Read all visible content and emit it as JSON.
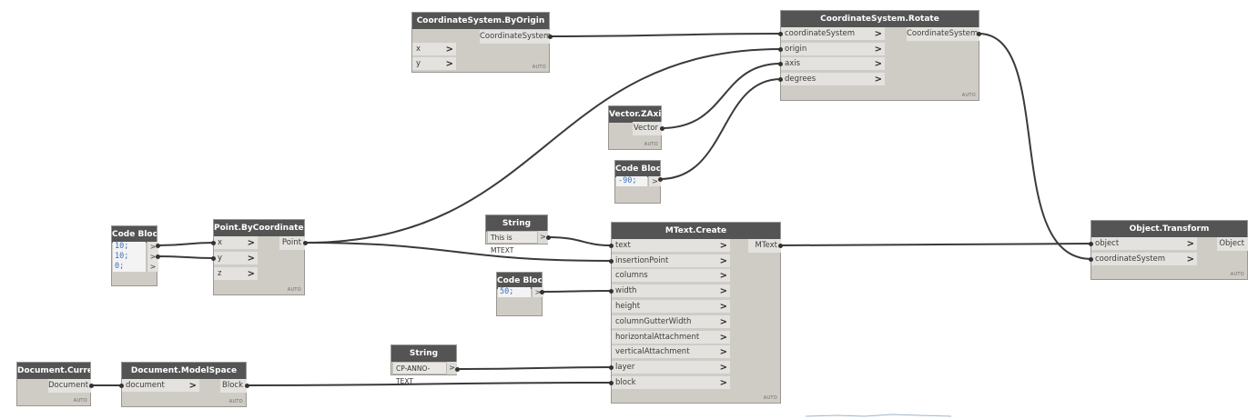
{
  "nodes": {
    "cs_by_origin": {
      "title": "CoordinateSystem.ByOrigin",
      "inputs": [
        "x",
        "y"
      ],
      "output": "CoordinateSystem",
      "lacing": "AUTO"
    },
    "cs_rotate": {
      "title": "CoordinateSystem.Rotate",
      "inputs": [
        "coordinateSystem",
        "origin",
        "axis",
        "degrees"
      ],
      "output": "CoordinateSystem",
      "lacing": "AUTO"
    },
    "vector_zaxis": {
      "title": "Vector.ZAxis",
      "output": "Vector",
      "lacing": "AUTO"
    },
    "code_block_degrees": {
      "title": "Code Block",
      "lines": [
        "-90;"
      ],
      "output_glyph": ">"
    },
    "code_block_xyz": {
      "title": "Code Block",
      "lines": [
        "10;",
        "10;",
        "0;"
      ],
      "output_glyph": ">"
    },
    "point_by_coords": {
      "title": "Point.ByCoordinates",
      "inputs": [
        "x",
        "y",
        "z"
      ],
      "output": "Point",
      "lacing": "AUTO"
    },
    "string_mtext": {
      "title": "String",
      "value": "This is MTEXT",
      "output_glyph": ">"
    },
    "code_block_width": {
      "title": "Code Block",
      "lines": [
        "50;"
      ],
      "output_glyph": ">"
    },
    "mtext_create": {
      "title": "MText.Create",
      "inputs": [
        "text",
        "insertionPoint",
        "columns",
        "width",
        "height",
        "columnGutterWidth",
        "horizontalAttachment",
        "verticalAttachment",
        "layer",
        "block"
      ],
      "output": "MText",
      "lacing": "AUTO"
    },
    "object_transform": {
      "title": "Object.Transform",
      "inputs": [
        "object",
        "coordinateSystem"
      ],
      "output": "Object",
      "lacing": "AUTO"
    },
    "string_layer": {
      "title": "String",
      "value": "CP-ANNO-TEXT",
      "output_glyph": ">"
    },
    "document_current": {
      "title": "Document.Current",
      "output": "Document",
      "lacing": "AUTO"
    },
    "document_modelspace": {
      "title": "Document.ModelSpace",
      "inputs": [
        "document"
      ],
      "output": "Block",
      "lacing": "AUTO"
    }
  },
  "chevron": ">",
  "colors": {
    "title_bar": "#545454",
    "node_body": "#cfccc6",
    "port": "#e4e2de",
    "wire": "#3a3a3a",
    "code_text": "#3a6ec4"
  }
}
